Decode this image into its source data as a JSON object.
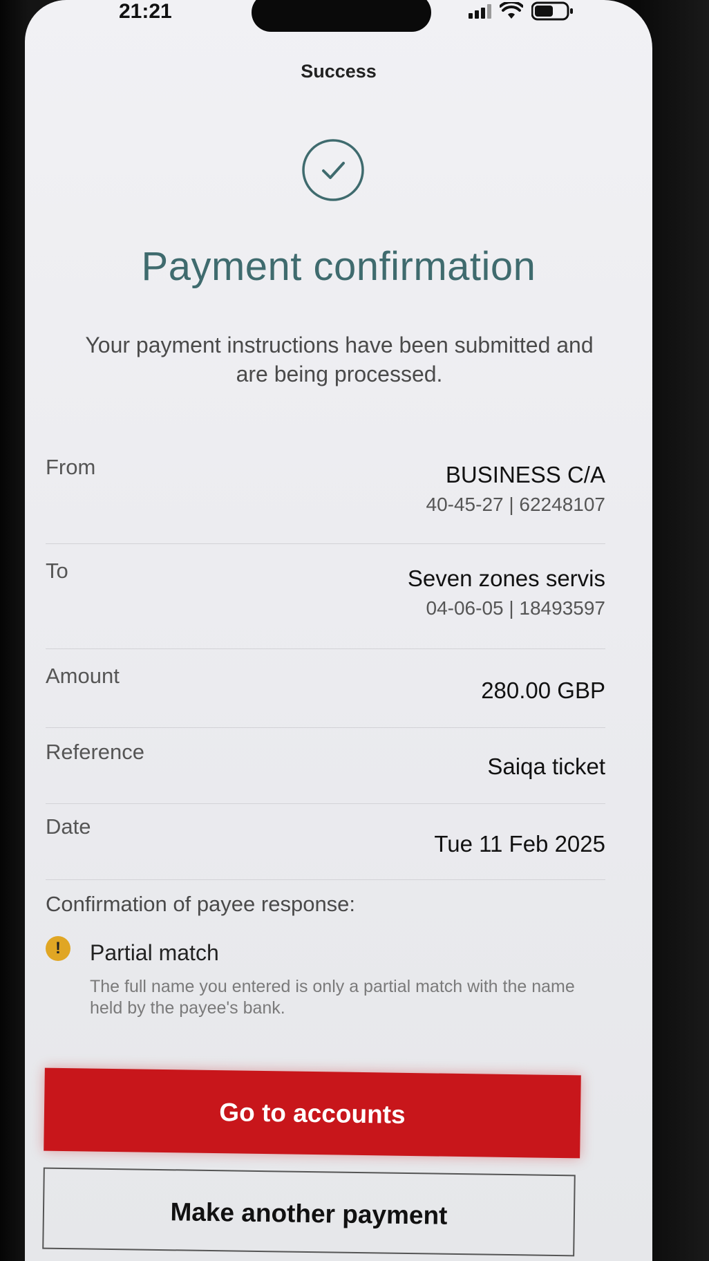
{
  "status_bar": {
    "time": "21:21",
    "icons": [
      "signal-icon",
      "wifi-icon",
      "battery-icon"
    ]
  },
  "header": {
    "title": "Success"
  },
  "status_icon": "check-circle-icon",
  "main": {
    "title": "Payment confirmation",
    "subtitle": "Your payment instructions have been submitted and are being processed."
  },
  "details": {
    "from": {
      "label": "From",
      "value": "BUSINESS C/A",
      "sub": "40-45-27 | 62248107"
    },
    "to": {
      "label": "To",
      "value": "Seven zones servis",
      "sub": "04-06-05 | 18493597"
    },
    "amount": {
      "label": "Amount",
      "value": "280.00 GBP"
    },
    "reference": {
      "label": "Reference",
      "value": "Saiqa ticket"
    },
    "date": {
      "label": "Date",
      "value": "Tue 11 Feb 2025"
    }
  },
  "confirmation_of_payee": {
    "title": "Confirmation of payee response:",
    "icon": "warning-icon",
    "icon_glyph": "!",
    "result": "Partial match",
    "description": "The full name you entered is only a partial match with the name held by the payee's bank."
  },
  "buttons": {
    "primary": "Go to accounts",
    "secondary": "Make another payment"
  },
  "colors": {
    "brand_red": "#c8161b",
    "title_teal": "#3f6b6e",
    "warning_amber": "#e0a624"
  }
}
